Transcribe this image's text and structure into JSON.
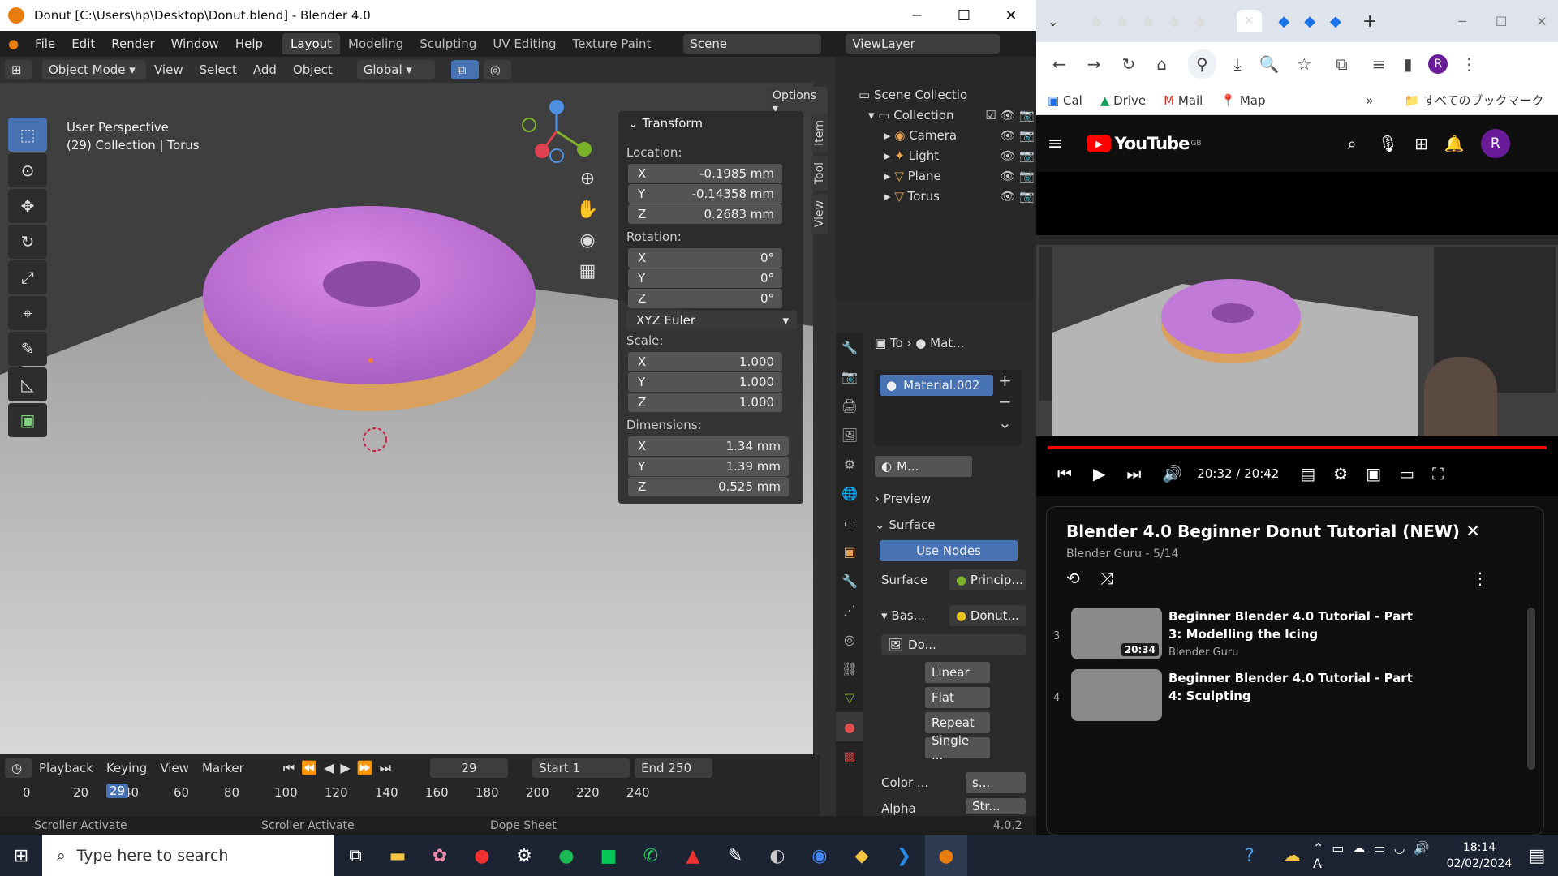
{
  "blender": {
    "title": "Donut [C:\\Users\\hp\\Desktop\\Donut.blend] - Blender 4.0",
    "menu": [
      "File",
      "Edit",
      "Render",
      "Window",
      "Help"
    ],
    "workspaces": [
      "Layout",
      "Modeling",
      "Sculpting",
      "UV Editing",
      "Texture Paint"
    ],
    "scene": "Scene",
    "view_layer": "ViewLayer",
    "vp_header": {
      "mode": "Object Mode",
      "items": [
        "View",
        "Select",
        "Add",
        "Object"
      ],
      "orientation": "Global",
      "options": "Options"
    },
    "vp_info": {
      "line1": "User Perspective",
      "line2": "(29) Collection | Torus"
    },
    "transform": {
      "title": "Transform",
      "location_label": "Location:",
      "location": [
        {
          "axis": "X",
          "value": "-0.1985 mm"
        },
        {
          "axis": "Y",
          "value": "-0.14358 mm"
        },
        {
          "axis": "Z",
          "value": "0.2683 mm"
        }
      ],
      "rotation_label": "Rotation:",
      "rotation": [
        {
          "axis": "X",
          "value": "0°"
        },
        {
          "axis": "Y",
          "value": "0°"
        },
        {
          "axis": "Z",
          "value": "0°"
        }
      ],
      "euler": "XYZ Euler",
      "scale_label": "Scale:",
      "scale": [
        {
          "axis": "X",
          "value": "1.000"
        },
        {
          "axis": "Y",
          "value": "1.000"
        },
        {
          "axis": "Z",
          "value": "1.000"
        }
      ],
      "dimensions_label": "Dimensions:",
      "dimensions": [
        {
          "axis": "X",
          "value": "1.34 mm"
        },
        {
          "axis": "Y",
          "value": "1.39 mm"
        },
        {
          "axis": "Z",
          "value": "0.525 mm"
        }
      ]
    },
    "ntabs": [
      "Item",
      "Tool",
      "View"
    ],
    "outliner": {
      "root": "Scene Collectio",
      "collection": "Collection",
      "items": [
        "Camera",
        "Light",
        "Plane",
        "Torus"
      ]
    },
    "props": {
      "breadcrumb_a": "To",
      "breadcrumb_b": "Mat...",
      "material": "Material.002",
      "mat_short": "M...",
      "preview": "Preview",
      "surface_section": "Surface",
      "use_nodes": "Use Nodes",
      "surface_label": "Surface",
      "surface_value": "Princip...",
      "base_label": "Bas...",
      "base_value": "Donut...",
      "image": "Do...",
      "linear": "Linear",
      "flat": "Flat",
      "repeat": "Repeat",
      "single": "Single ...",
      "color_label": "Color ...",
      "color_value": "s...",
      "alpha_label": "Alpha",
      "alpha_value": "Str..."
    },
    "timeline": {
      "items": [
        "Playback",
        "Keying",
        "View",
        "Marker"
      ],
      "current": "29",
      "start_label": "Start",
      "start": "1",
      "end_label": "End",
      "end": "250",
      "ticks": [
        "0",
        "20",
        "40",
        "60",
        "80",
        "100",
        "120",
        "140",
        "160",
        "180",
        "200",
        "220",
        "240"
      ]
    },
    "status": {
      "a": "Scroller Activate",
      "b": "Scroller Activate",
      "c": "Dope Sheet",
      "version": "4.0.2"
    }
  },
  "chrome": {
    "bookmarks": [
      "Cal",
      "Drive",
      "Mail",
      "Map"
    ],
    "all_bookmarks": "すべてのブックマーク",
    "youtube": {
      "logo": "YouTube",
      "region": "GB",
      "time": "20:32 / 20:42",
      "playlist_title": "Blender 4.0 Beginner Donut Tutorial (NEW)",
      "playlist_sub": "Blender Guru - 5/14",
      "items": [
        {
          "num": "3",
          "title": "Beginner Blender 4.0 Tutorial - Part 3: Modelling the Icing",
          "channel": "Blender Guru",
          "duration": "20:34"
        },
        {
          "num": "4",
          "title": "Beginner Blender 4.0 Tutorial - Part 4: Sculpting",
          "channel": "",
          "duration": ""
        }
      ]
    }
  },
  "taskbar": {
    "search": "Type here to search",
    "time": "18:14",
    "date": "02/02/2024"
  },
  "colors": {
    "accent": "#4772b3",
    "donut_icing": "#c275d8",
    "youtube_red": "#ff0000"
  }
}
